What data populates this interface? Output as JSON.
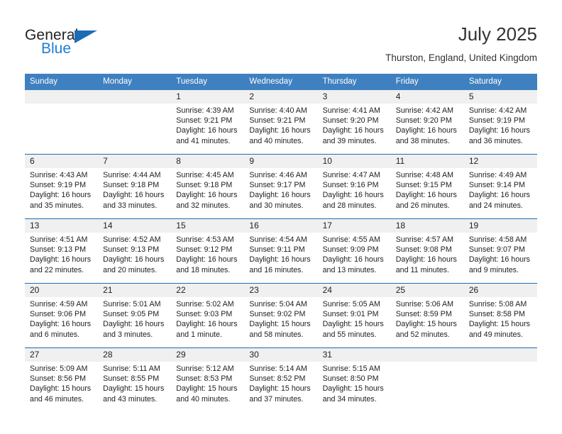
{
  "brand": {
    "name_primary": "General",
    "name_secondary": "Blue",
    "triangle_icon": "blue-triangle-icon",
    "accent_color": "#1c7fd4"
  },
  "header": {
    "month_title": "July 2025",
    "location": "Thurston, England, United Kingdom"
  },
  "theme": {
    "header_row_bg": "#3f80c0",
    "day_number_band_bg": "#f0f0f0",
    "row_divider": "#1c6cb5",
    "text_color": "#222222"
  },
  "calendar": {
    "weekdays": [
      "Sunday",
      "Monday",
      "Tuesday",
      "Wednesday",
      "Thursday",
      "Friday",
      "Saturday"
    ],
    "weeks": [
      [
        {
          "day": "",
          "lines": []
        },
        {
          "day": "",
          "lines": []
        },
        {
          "day": "1",
          "lines": [
            "Sunrise: 4:39 AM",
            "Sunset: 9:21 PM",
            "Daylight: 16 hours",
            "and 41 minutes."
          ]
        },
        {
          "day": "2",
          "lines": [
            "Sunrise: 4:40 AM",
            "Sunset: 9:21 PM",
            "Daylight: 16 hours",
            "and 40 minutes."
          ]
        },
        {
          "day": "3",
          "lines": [
            "Sunrise: 4:41 AM",
            "Sunset: 9:20 PM",
            "Daylight: 16 hours",
            "and 39 minutes."
          ]
        },
        {
          "day": "4",
          "lines": [
            "Sunrise: 4:42 AM",
            "Sunset: 9:20 PM",
            "Daylight: 16 hours",
            "and 38 minutes."
          ]
        },
        {
          "day": "5",
          "lines": [
            "Sunrise: 4:42 AM",
            "Sunset: 9:19 PM",
            "Daylight: 16 hours",
            "and 36 minutes."
          ]
        }
      ],
      [
        {
          "day": "6",
          "lines": [
            "Sunrise: 4:43 AM",
            "Sunset: 9:19 PM",
            "Daylight: 16 hours",
            "and 35 minutes."
          ]
        },
        {
          "day": "7",
          "lines": [
            "Sunrise: 4:44 AM",
            "Sunset: 9:18 PM",
            "Daylight: 16 hours",
            "and 33 minutes."
          ]
        },
        {
          "day": "8",
          "lines": [
            "Sunrise: 4:45 AM",
            "Sunset: 9:18 PM",
            "Daylight: 16 hours",
            "and 32 minutes."
          ]
        },
        {
          "day": "9",
          "lines": [
            "Sunrise: 4:46 AM",
            "Sunset: 9:17 PM",
            "Daylight: 16 hours",
            "and 30 minutes."
          ]
        },
        {
          "day": "10",
          "lines": [
            "Sunrise: 4:47 AM",
            "Sunset: 9:16 PM",
            "Daylight: 16 hours",
            "and 28 minutes."
          ]
        },
        {
          "day": "11",
          "lines": [
            "Sunrise: 4:48 AM",
            "Sunset: 9:15 PM",
            "Daylight: 16 hours",
            "and 26 minutes."
          ]
        },
        {
          "day": "12",
          "lines": [
            "Sunrise: 4:49 AM",
            "Sunset: 9:14 PM",
            "Daylight: 16 hours",
            "and 24 minutes."
          ]
        }
      ],
      [
        {
          "day": "13",
          "lines": [
            "Sunrise: 4:51 AM",
            "Sunset: 9:13 PM",
            "Daylight: 16 hours",
            "and 22 minutes."
          ]
        },
        {
          "day": "14",
          "lines": [
            "Sunrise: 4:52 AM",
            "Sunset: 9:13 PM",
            "Daylight: 16 hours",
            "and 20 minutes."
          ]
        },
        {
          "day": "15",
          "lines": [
            "Sunrise: 4:53 AM",
            "Sunset: 9:12 PM",
            "Daylight: 16 hours",
            "and 18 minutes."
          ]
        },
        {
          "day": "16",
          "lines": [
            "Sunrise: 4:54 AM",
            "Sunset: 9:11 PM",
            "Daylight: 16 hours",
            "and 16 minutes."
          ]
        },
        {
          "day": "17",
          "lines": [
            "Sunrise: 4:55 AM",
            "Sunset: 9:09 PM",
            "Daylight: 16 hours",
            "and 13 minutes."
          ]
        },
        {
          "day": "18",
          "lines": [
            "Sunrise: 4:57 AM",
            "Sunset: 9:08 PM",
            "Daylight: 16 hours",
            "and 11 minutes."
          ]
        },
        {
          "day": "19",
          "lines": [
            "Sunrise: 4:58 AM",
            "Sunset: 9:07 PM",
            "Daylight: 16 hours",
            "and 9 minutes."
          ]
        }
      ],
      [
        {
          "day": "20",
          "lines": [
            "Sunrise: 4:59 AM",
            "Sunset: 9:06 PM",
            "Daylight: 16 hours",
            "and 6 minutes."
          ]
        },
        {
          "day": "21",
          "lines": [
            "Sunrise: 5:01 AM",
            "Sunset: 9:05 PM",
            "Daylight: 16 hours",
            "and 3 minutes."
          ]
        },
        {
          "day": "22",
          "lines": [
            "Sunrise: 5:02 AM",
            "Sunset: 9:03 PM",
            "Daylight: 16 hours",
            "and 1 minute."
          ]
        },
        {
          "day": "23",
          "lines": [
            "Sunrise: 5:04 AM",
            "Sunset: 9:02 PM",
            "Daylight: 15 hours",
            "and 58 minutes."
          ]
        },
        {
          "day": "24",
          "lines": [
            "Sunrise: 5:05 AM",
            "Sunset: 9:01 PM",
            "Daylight: 15 hours",
            "and 55 minutes."
          ]
        },
        {
          "day": "25",
          "lines": [
            "Sunrise: 5:06 AM",
            "Sunset: 8:59 PM",
            "Daylight: 15 hours",
            "and 52 minutes."
          ]
        },
        {
          "day": "26",
          "lines": [
            "Sunrise: 5:08 AM",
            "Sunset: 8:58 PM",
            "Daylight: 15 hours",
            "and 49 minutes."
          ]
        }
      ],
      [
        {
          "day": "27",
          "lines": [
            "Sunrise: 5:09 AM",
            "Sunset: 8:56 PM",
            "Daylight: 15 hours",
            "and 46 minutes."
          ]
        },
        {
          "day": "28",
          "lines": [
            "Sunrise: 5:11 AM",
            "Sunset: 8:55 PM",
            "Daylight: 15 hours",
            "and 43 minutes."
          ]
        },
        {
          "day": "29",
          "lines": [
            "Sunrise: 5:12 AM",
            "Sunset: 8:53 PM",
            "Daylight: 15 hours",
            "and 40 minutes."
          ]
        },
        {
          "day": "30",
          "lines": [
            "Sunrise: 5:14 AM",
            "Sunset: 8:52 PM",
            "Daylight: 15 hours",
            "and 37 minutes."
          ]
        },
        {
          "day": "31",
          "lines": [
            "Sunrise: 5:15 AM",
            "Sunset: 8:50 PM",
            "Daylight: 15 hours",
            "and 34 minutes."
          ]
        },
        {
          "day": "",
          "lines": []
        },
        {
          "day": "",
          "lines": []
        }
      ]
    ]
  }
}
